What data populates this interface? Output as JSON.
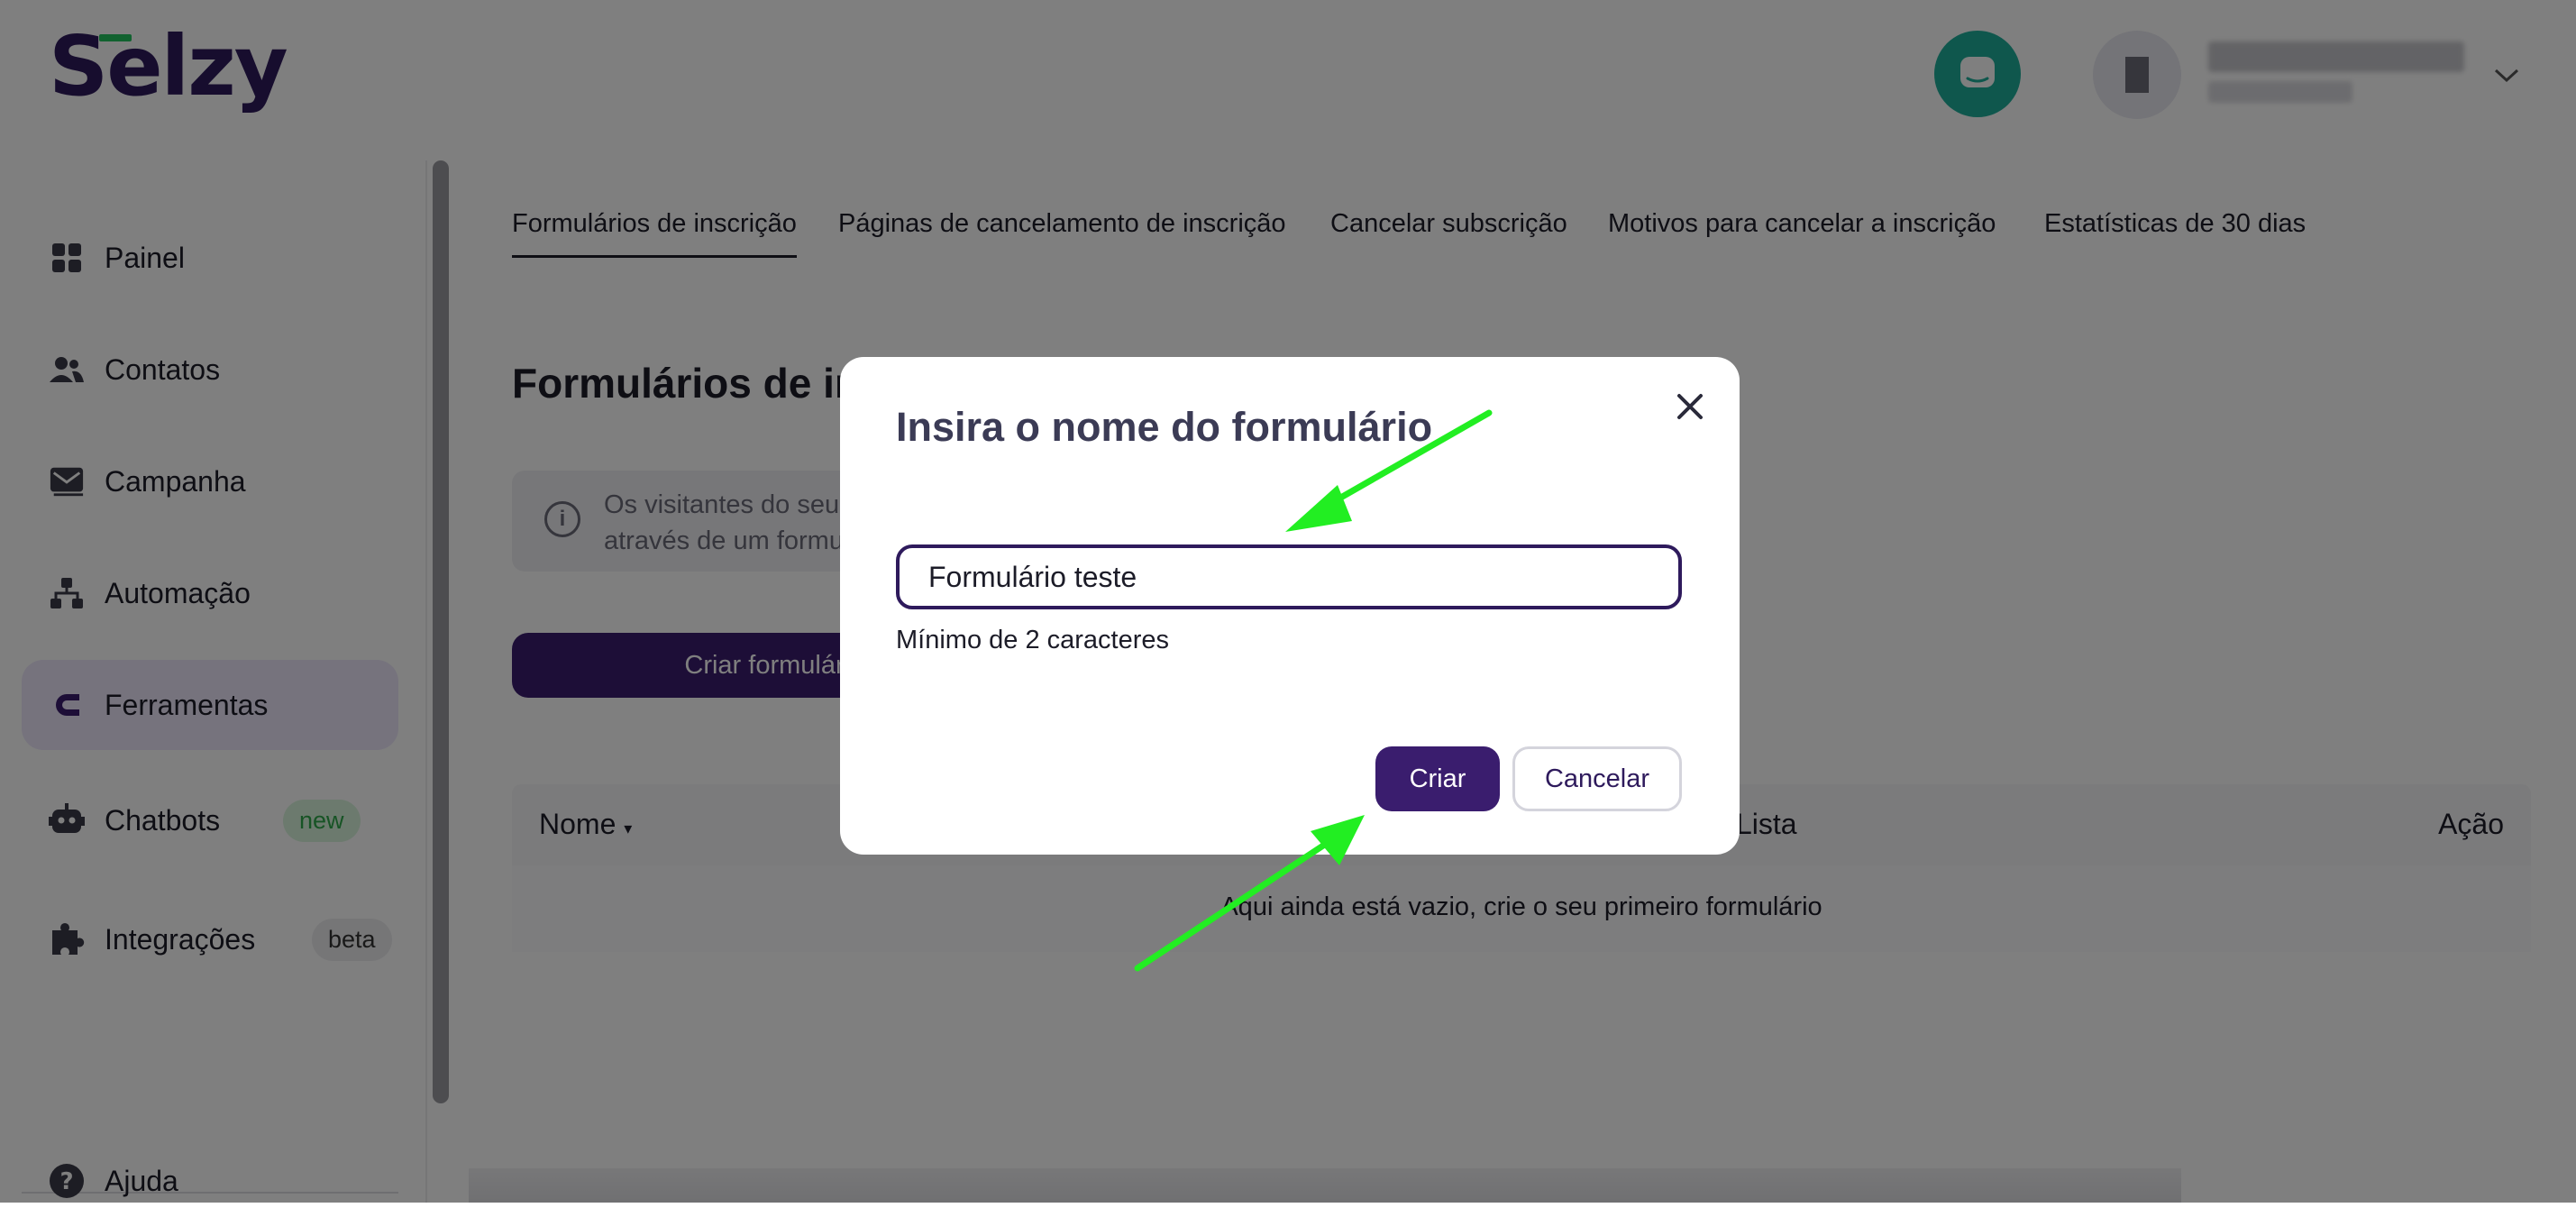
{
  "brand": {
    "logo_text": "Selzy",
    "accent_color": "#3a1d6e",
    "logo_accent": "#22c55e"
  },
  "header": {
    "chat_icon": "chat-icon",
    "chevron_icon": "chevron-down-icon"
  },
  "sidebar": {
    "items": [
      {
        "label": "Painel",
        "icon": "dashboard-grid-icon"
      },
      {
        "label": "Contatos",
        "icon": "users-icon"
      },
      {
        "label": "Campanha",
        "icon": "mail-icon"
      },
      {
        "label": "Automação",
        "icon": "hierarchy-icon"
      },
      {
        "label": "Ferramentas",
        "icon": "magnet-icon",
        "active": true
      },
      {
        "label": "Chatbots",
        "icon": "robot-icon",
        "badge": "new"
      },
      {
        "label": "Integrações",
        "icon": "puzzle-icon",
        "badge": "beta"
      },
      {
        "label": "Ajuda",
        "icon": "help-icon"
      }
    ]
  },
  "tabs": [
    {
      "label": "Formulários de inscrição",
      "active": true
    },
    {
      "label": "Páginas de cancelamento de inscrição"
    },
    {
      "label": "Cancelar subscrição"
    },
    {
      "label": "Motivos para cancelar a inscrição"
    },
    {
      "label": "Estatísticas de 30 dias"
    }
  ],
  "main": {
    "title": "Formulários de in",
    "info_text_line1": "Os visitantes do seu",
    "info_text_line2": "através de um formu",
    "create_button": "Criar formulár",
    "table": {
      "col_name": "Nome",
      "col_list": "Lista",
      "col_action": "Ação",
      "empty_text": "Aqui ainda está vazio, crie o seu primeiro formulário"
    }
  },
  "modal": {
    "title": "Insira o nome do formulário",
    "input_value": "Formulário teste",
    "hint": "Mínimo de 2 caracteres",
    "create_label": "Criar",
    "cancel_label": "Cancelar"
  },
  "annotation": {
    "arrow_color": "#22ee22"
  }
}
